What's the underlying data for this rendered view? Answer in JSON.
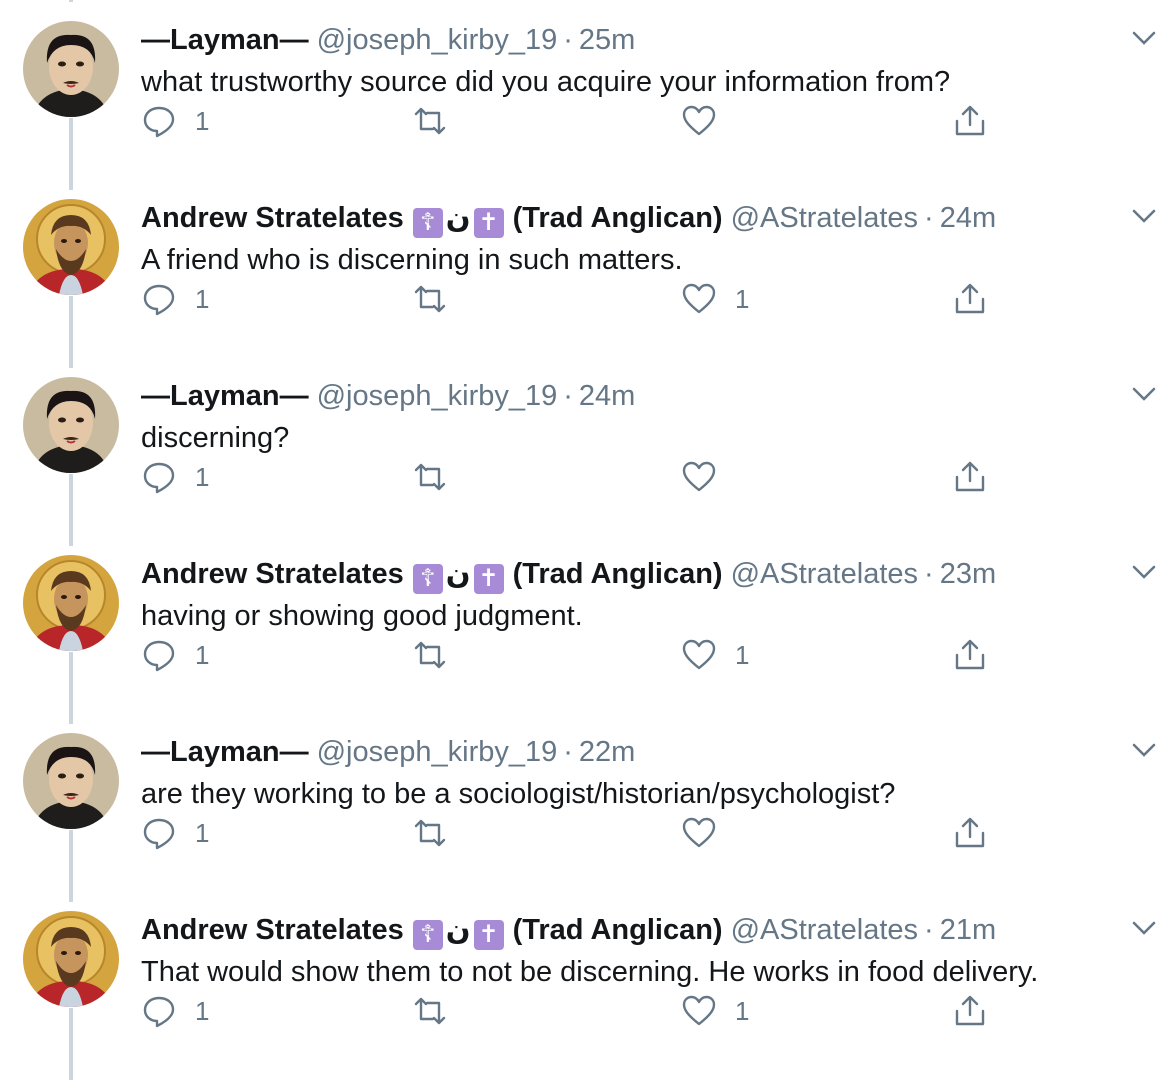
{
  "colors": {
    "text": "#14171a",
    "muted": "#657786",
    "thread_line": "#ccd6dd",
    "emoji_bg": "#a78bd6"
  },
  "users": {
    "layman": {
      "name": "—Layman—",
      "handle": "@joseph_kirby_19"
    },
    "andrew": {
      "name": "Andrew Stratelates",
      "emoji1": "☦",
      "glyph": "ن",
      "emoji2": "✝",
      "suffix": "(Trad Anglican)",
      "handle": "@AStratelates"
    }
  },
  "tweets": [
    {
      "time": "25m",
      "text": "what trustworthy source did you acquire your information from?",
      "reply_count": "1",
      "like_count": ""
    },
    {
      "time": "24m",
      "text": "A friend who is discerning in such matters.",
      "reply_count": "1",
      "like_count": "1"
    },
    {
      "time": "24m",
      "text": "discerning?",
      "reply_count": "1",
      "like_count": ""
    },
    {
      "time": "23m",
      "text": "having or showing good judgment.",
      "reply_count": "1",
      "like_count": "1"
    },
    {
      "time": "22m",
      "text": "are they working to be a sociologist/historian/psychologist?",
      "reply_count": "1",
      "like_count": ""
    },
    {
      "time": "21m",
      "text": "That would show them to not be discerning. He works in food delivery.",
      "reply_count": "1",
      "like_count": "1"
    }
  ],
  "dot": "·",
  "icons": {
    "reply": "reply-icon",
    "retweet": "retweet-icon",
    "like": "like-icon",
    "share": "share-icon",
    "more": "chevron-down-icon"
  }
}
